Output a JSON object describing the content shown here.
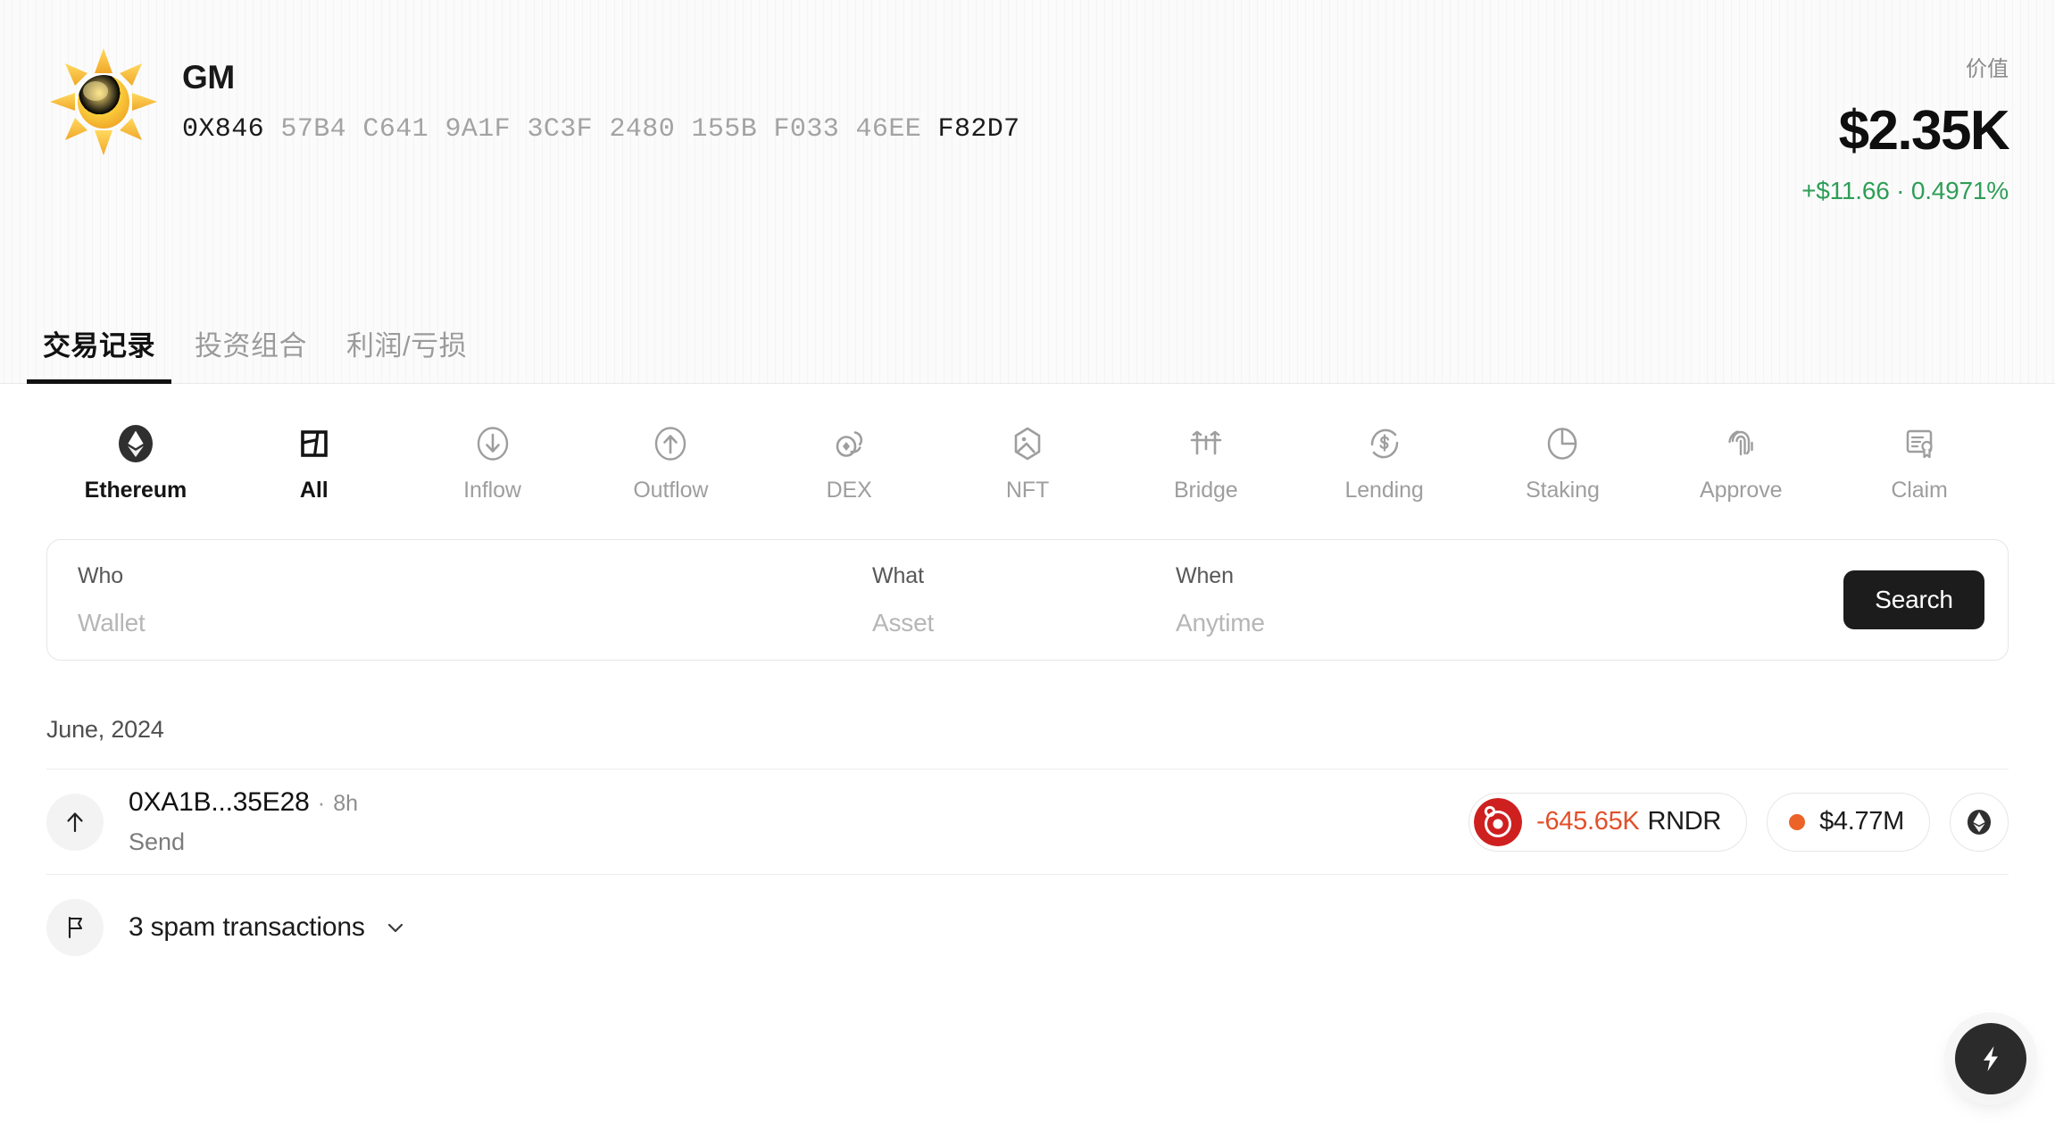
{
  "profile": {
    "avatar_icon": "sun-emoji",
    "name": "GM",
    "address_prefix": "0X846",
    "address_middle": "57B4 C641 9A1F 3C3F 2480 155B F033 46EE",
    "address_suffix": "F82D7"
  },
  "value": {
    "label": "价值",
    "amount": "$2.35K",
    "change": "+$11.66 · 0.4971%",
    "change_color": "#2e9e57"
  },
  "tabs": [
    {
      "label": "交易记录",
      "active": true
    },
    {
      "label": "投资组合",
      "active": false
    },
    {
      "label": "利润/亏损",
      "active": false
    }
  ],
  "filters": [
    {
      "label": "Ethereum",
      "icon": "ethereum-icon",
      "active": true
    },
    {
      "label": "All",
      "icon": "all-icon",
      "active": true
    },
    {
      "label": "Inflow",
      "icon": "arrow-down-circle-icon",
      "active": false
    },
    {
      "label": "Outflow",
      "icon": "arrow-up-circle-icon",
      "active": false
    },
    {
      "label": "DEX",
      "icon": "dex-swap-icon",
      "active": false
    },
    {
      "label": "NFT",
      "icon": "nft-hexagon-icon",
      "active": false
    },
    {
      "label": "Bridge",
      "icon": "bridge-icon",
      "active": false
    },
    {
      "label": "Lending",
      "icon": "lending-dollar-icon",
      "active": false
    },
    {
      "label": "Staking",
      "icon": "staking-pie-icon",
      "active": false
    },
    {
      "label": "Approve",
      "icon": "fingerprint-icon",
      "active": false
    },
    {
      "label": "Claim",
      "icon": "certificate-icon",
      "active": false
    }
  ],
  "search": {
    "who_label": "Who",
    "who_placeholder": "Wallet",
    "what_label": "What",
    "what_placeholder": "Asset",
    "when_label": "When",
    "when_placeholder": "Anytime",
    "button_label": "Search"
  },
  "transactions": {
    "month_label": "June, 2024",
    "rows": [
      {
        "direction_icon": "arrow-up-icon",
        "title": "0XA1B...35E28",
        "separator": "·",
        "time": "8h",
        "subtitle": "Send",
        "amount": "-645.65K",
        "amount_color": "#e2502a",
        "symbol": "RNDR",
        "token_icon": "rndr-token-icon",
        "token_color": "#cf2020",
        "usd_value": "$4.77M",
        "usd_dot_color": "#ec6327",
        "chain_icon": "ethereum-icon"
      }
    ],
    "spam": {
      "icon": "flag-icon",
      "label": "3 spam transactions",
      "chevron": "chevron-down-icon"
    }
  },
  "fab": {
    "icon": "lightning-bolt-icon"
  }
}
